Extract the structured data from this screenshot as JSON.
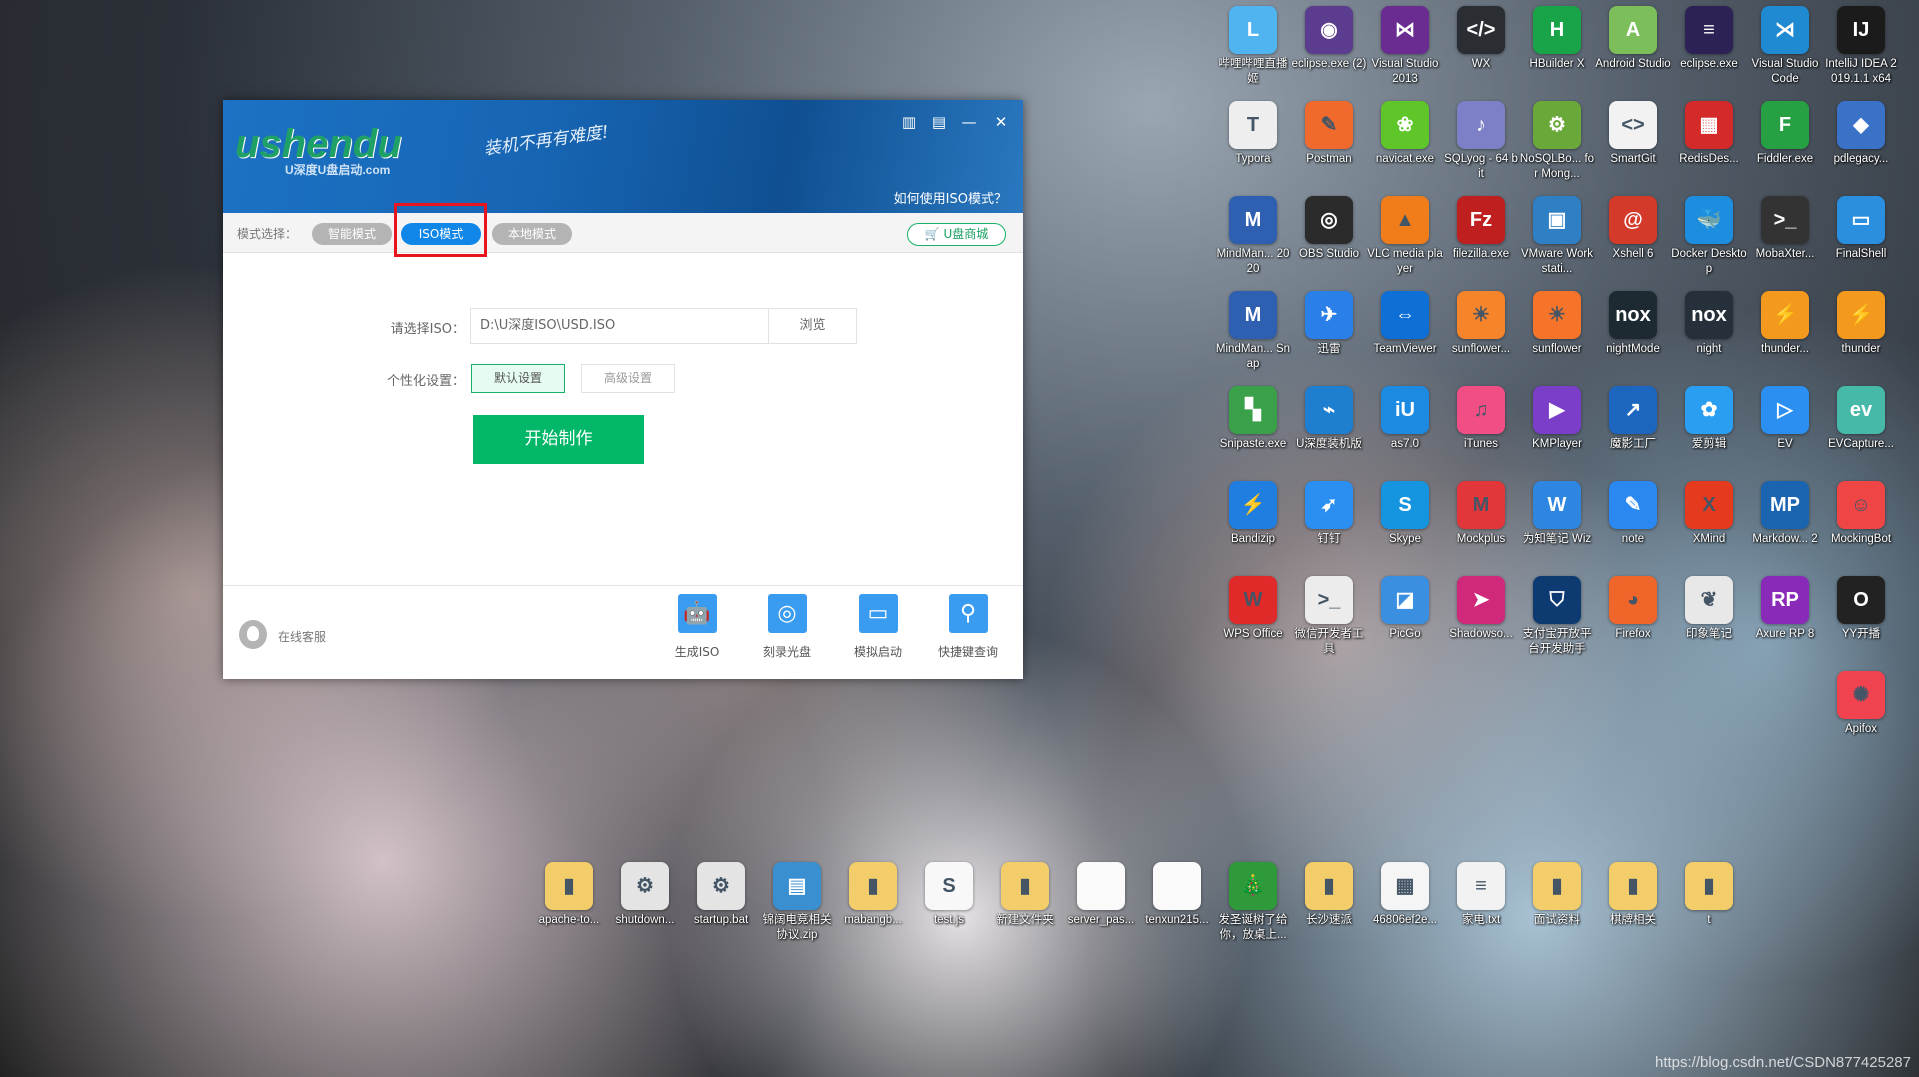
{
  "window": {
    "logo": "ushendu",
    "logo_sub": "U深度U盘启动.com",
    "slogan": "装机不再有难度!",
    "help_link": "如何使用ISO模式？",
    "header_icons": [
      "book-icon",
      "feedback-icon",
      "minimize-icon",
      "close-icon"
    ],
    "mode": {
      "label": "模式选择：",
      "options": [
        "智能模式",
        "ISO模式",
        "本地模式"
      ],
      "selected": "ISO模式",
      "shop": "U盘商城"
    },
    "form": {
      "iso_label": "请选择ISO：",
      "iso_value": "D:\\U深度ISO\\USD.ISO",
      "browse": "浏览",
      "custom_label": "个性化设置：",
      "default_settings": "默认设置",
      "advanced_settings": "高级设置",
      "start": "开始制作"
    },
    "footer": {
      "service": "在线客服",
      "tools": [
        {
          "label": "生成ISO",
          "icon": "robot-icon"
        },
        {
          "label": "刻录光盘",
          "icon": "disc-icon"
        },
        {
          "label": "模拟启动",
          "icon": "monitor-icon"
        },
        {
          "label": "快捷键查询",
          "icon": "search-icon"
        }
      ]
    },
    "colors": {
      "header": "#1765b3",
      "active": "#0f86e8",
      "green": "#02b768",
      "highlight": "#e8141e"
    }
  },
  "desktop": {
    "grid": [
      [
        {
          "l": "哔哩哔哩直播姬",
          "c": "#4fb4f0",
          "g": "L"
        },
        {
          "l": "eclipse.exe (2)",
          "c": "#5b3c8f",
          "g": "◉"
        },
        {
          "l": "Visual Studio 2013",
          "c": "#6a2c91",
          "g": "⋈"
        },
        {
          "l": "WX",
          "c": "#2a2e33",
          "g": "</>"
        },
        {
          "l": "HBuilder X",
          "c": "#1aa44a",
          "g": "H"
        },
        {
          "l": "Android Studio",
          "c": "#7cbf5a",
          "g": "A"
        },
        {
          "l": "eclipse.exe",
          "c": "#2c2255",
          "g": "≡"
        },
        {
          "l": "Visual Studio Code",
          "c": "#1f8ad2",
          "g": "⋊"
        },
        {
          "l": "IntelliJ IDEA 2019.1.1 x64",
          "c": "#1b1b1b",
          "g": "IJ"
        }
      ],
      [
        {
          "l": "Typora",
          "c": "#eeeeee",
          "g": "T"
        },
        {
          "l": "Postman",
          "c": "#f06a2e",
          "g": "✎"
        },
        {
          "l": "navicat.exe",
          "c": "#5fc62a",
          "g": "❀"
        },
        {
          "l": "SQLyog - 64 bit",
          "c": "#7d7fc7",
          "g": "♪"
        },
        {
          "l": "NoSQLBo... for Mong...",
          "c": "#6aa83a",
          "g": "⚙"
        },
        {
          "l": "SmartGit",
          "c": "#f2f2f2",
          "g": "<>"
        },
        {
          "l": "RedisDes...",
          "c": "#d42a2a",
          "g": "▦"
        },
        {
          "l": "Fiddler.exe",
          "c": "#27a043",
          "g": "F"
        },
        {
          "l": "pdlegacy...",
          "c": "#3a72c8",
          "g": "◆"
        }
      ],
      [
        {
          "l": "MindMan... 2020",
          "c": "#2e5fb0",
          "g": "M"
        },
        {
          "l": "OBS Studio",
          "c": "#2b2b2b",
          "g": "◎"
        },
        {
          "l": "VLC media player",
          "c": "#f07d1a",
          "g": "▲"
        },
        {
          "l": "filezilla.exe",
          "c": "#bf1f1f",
          "g": "Fz"
        },
        {
          "l": "VMware Workstati...",
          "c": "#2f7fc4",
          "g": "▣"
        },
        {
          "l": "Xshell 6",
          "c": "#d33a2a",
          "g": "@"
        },
        {
          "l": "Docker Desktop",
          "c": "#1d8de0",
          "g": "🐳"
        },
        {
          "l": "MobaXter...",
          "c": "#333",
          "g": ">_"
        },
        {
          "l": "FinalShell",
          "c": "#2b8fe0",
          "g": "▭"
        }
      ],
      [
        {
          "l": "MindMan... Snap",
          "c": "#2e5fb0",
          "g": "M"
        },
        {
          "l": "迅雷",
          "c": "#2a80e8",
          "g": "✈"
        },
        {
          "l": "TeamViewer",
          "c": "#0e6fd6",
          "g": "⇔"
        },
        {
          "l": "sunflower...",
          "c": "#f5842a",
          "g": "☀"
        },
        {
          "l": "sunflower",
          "c": "#f5742a",
          "g": "☀"
        },
        {
          "l": "nightMode",
          "c": "#1e2a32",
          "g": "nox"
        },
        {
          "l": "night",
          "c": "#26303a",
          "g": "nox"
        },
        {
          "l": "thunder...",
          "c": "#f39a1e",
          "g": "⚡"
        },
        {
          "l": "thunder",
          "c": "#f39a1e",
          "g": "⚡"
        }
      ],
      [
        {
          "l": "Snipaste.exe",
          "c": "#3aa04a",
          "g": "▚"
        },
        {
          "l": "U深度装机版",
          "c": "#1e7fd0",
          "g": "⌁"
        },
        {
          "l": "as7.0",
          "c": "#1c8ae0",
          "g": "iU"
        },
        {
          "l": "iTunes",
          "c": "#f14e86",
          "g": "♫"
        },
        {
          "l": "KMPlayer",
          "c": "#7b3ec8",
          "g": "▶"
        },
        {
          "l": "魔影工厂",
          "c": "#1d66c0",
          "g": "↗"
        },
        {
          "l": "爱剪辑",
          "c": "#2a9ef0",
          "g": "✿"
        },
        {
          "l": "EV",
          "c": "#2a8ff0",
          "g": "▷"
        },
        {
          "l": "EVCapture...",
          "c": "#46b9a8",
          "g": "ev"
        }
      ],
      [
        {
          "l": "Bandizip",
          "c": "#1f7ee0",
          "g": "⚡"
        },
        {
          "l": "钉钉",
          "c": "#2a8ff0",
          "g": "➶"
        },
        {
          "l": "Skype",
          "c": "#1595e0",
          "g": "S"
        },
        {
          "l": "Mockplus",
          "c": "#e2363a",
          "g": "M"
        },
        {
          "l": "为知笔记 Wiz",
          "c": "#2f86e0",
          "g": "W"
        },
        {
          "l": "note",
          "c": "#2a88f0",
          "g": "✎"
        },
        {
          "l": "XMind",
          "c": "#e63a1e",
          "g": "X"
        },
        {
          "l": "Markdow... 2",
          "c": "#1b64b0",
          "g": "MP"
        },
        {
          "l": "MockingBot",
          "c": "#f04545",
          "g": "☺"
        }
      ],
      [
        {
          "l": "WPS Office",
          "c": "#e02a2a",
          "g": "W"
        },
        {
          "l": "微信开发者工具",
          "c": "#ececec",
          "g": ">_"
        },
        {
          "l": "PicGo",
          "c": "#3a8fe0",
          "g": "◪"
        },
        {
          "l": "Shadowso...",
          "c": "#d0287a",
          "g": "➤"
        },
        {
          "l": "支付宝开放平台开发助手",
          "c": "#0e3a72",
          "g": "⛉"
        },
        {
          "l": "Firefox",
          "c": "#f0662a",
          "g": "◕"
        },
        {
          "l": "印象笔记",
          "c": "#e8e8e8",
          "g": "❦"
        },
        {
          "l": "Axure RP 8",
          "c": "#8a2ab8",
          "g": "RP"
        },
        {
          "l": "YY开播",
          "c": "#222",
          "g": "O"
        }
      ],
      [
        null,
        null,
        null,
        null,
        null,
        null,
        null,
        null,
        {
          "l": "Apifox",
          "c": "#f0434f",
          "g": "✺"
        }
      ]
    ],
    "bottom": [
      {
        "l": "apache-to...",
        "c": "#f3cd6a",
        "g": "▮"
      },
      {
        "l": "shutdown...",
        "c": "#e4e4e4",
        "g": "⚙"
      },
      {
        "l": "startup.bat",
        "c": "#e4e4e4",
        "g": "⚙"
      },
      {
        "l": "锦阔电竞相关协议.zip",
        "c": "#3a8fd0",
        "g": "▤"
      },
      {
        "l": "mabangb...",
        "c": "#f3cd6a",
        "g": "▮"
      },
      {
        "l": "test.js",
        "c": "#f8f8f8",
        "g": "S"
      },
      {
        "l": "新建文件夹",
        "c": "#f3cd6a",
        "g": "▮"
      },
      {
        "l": "server_pas...",
        "c": "#fafafa",
        "g": ""
      },
      {
        "l": "tenxun215...",
        "c": "#fafafa",
        "g": ""
      },
      {
        "l": "发圣诞树了给你，放桌上...",
        "c": "#2f9a3a",
        "g": "🎄"
      },
      {
        "l": "长沙速派",
        "c": "#f3cd6a",
        "g": "▮"
      },
      {
        "l": "46806ef2e...",
        "c": "#f5f5f5",
        "g": "▦"
      },
      {
        "l": "家电.txt",
        "c": "#f2f2f2",
        "g": "≡"
      },
      {
        "l": "面试资料",
        "c": "#f3cd6a",
        "g": "▮"
      },
      {
        "l": "棋牌相关",
        "c": "#f3cd6a",
        "g": "▮"
      },
      {
        "l": "t",
        "c": "#f3cd6a",
        "g": "▮"
      }
    ],
    "watermark": "https://blog.csdn.net/CSDN877425287"
  }
}
